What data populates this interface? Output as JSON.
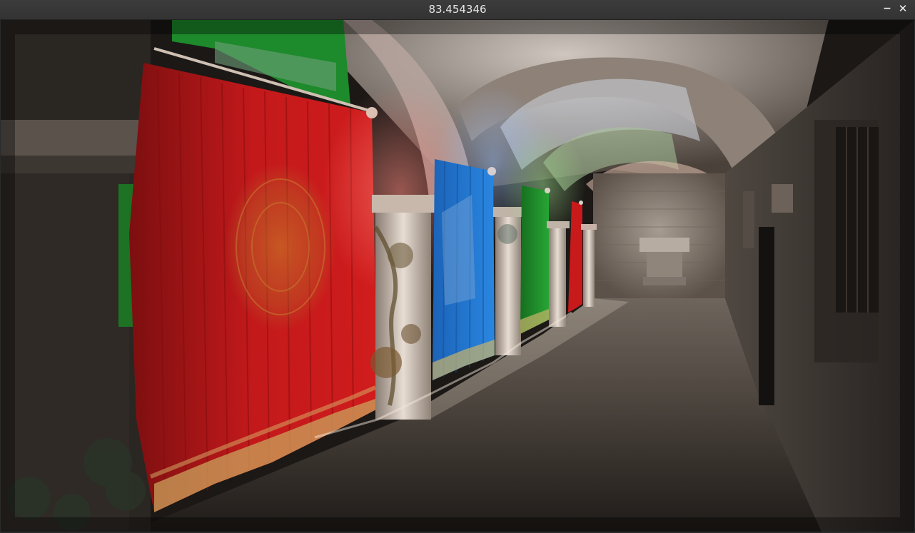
{
  "window": {
    "title": "83.454346",
    "minimize_glyph": "−",
    "close_glyph": "✕"
  },
  "viewport": {
    "scene": "rendered-3d-corridor",
    "colors": {
      "curtain_red": "#c0181a",
      "curtain_blue": "#1f6fc4",
      "curtain_green": "#1f8f2a",
      "stone": "#9c8f83",
      "shadow": "#1b1816"
    }
  }
}
